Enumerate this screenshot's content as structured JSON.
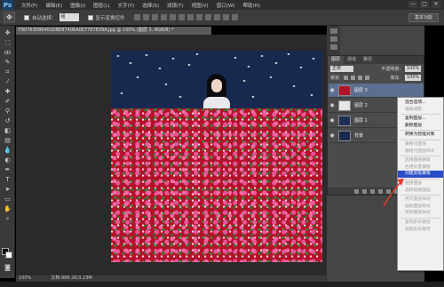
{
  "app": {
    "logo": "Ps"
  },
  "menu": [
    "文件(F)",
    "编辑(E)",
    "图像(I)",
    "图层(L)",
    "文字(Y)",
    "选择(S)",
    "滤镜(T)",
    "视图(V)",
    "窗口(W)",
    "帮助(H)"
  ],
  "window_controls": [
    "—",
    "□",
    "✕"
  ],
  "options": {
    "auto_select_label": "自动选择：",
    "auto_select_value": "组",
    "show_transform_label": "显示变换控件",
    "essentials": "基本功能"
  },
  "document": {
    "tab_title": "F90763086401DBE87406A0E77E7E09A.jpg @ 100% (图层 3, RGB/8) *",
    "zoom": "100%",
    "doc_info": "文档:986.2K/3.23M"
  },
  "layers_panel": {
    "tabs": [
      "图层",
      "通道",
      "路径"
    ],
    "blend_mode": "正常",
    "opacity_label": "不透明度:",
    "opacity_value": "100%",
    "lock_label": "锁定:",
    "fill_label": "填充:",
    "fill_value": "100%",
    "layers": [
      {
        "name": "图层 3",
        "selected": true
      },
      {
        "name": "图层 2",
        "selected": false
      },
      {
        "name": "图层 1",
        "selected": false
      },
      {
        "name": "背景",
        "selected": false
      }
    ]
  },
  "context_menu": [
    {
      "label": "混合选项...",
      "state": "normal"
    },
    {
      "label": "编辑调整...",
      "state": "disabled"
    },
    {
      "sep": true
    },
    {
      "label": "复制图层...",
      "state": "normal"
    },
    {
      "label": "删除图层",
      "state": "normal"
    },
    {
      "sep": true
    },
    {
      "label": "转换为智能对象",
      "state": "normal"
    },
    {
      "sep": true
    },
    {
      "label": "栅格化图层",
      "state": "disabled"
    },
    {
      "label": "栅格化图层样式",
      "state": "disabled"
    },
    {
      "sep": true
    },
    {
      "label": "启用图层蒙版",
      "state": "disabled"
    },
    {
      "label": "启用矢量蒙版",
      "state": "disabled"
    },
    {
      "label": "创建剪贴蒙版",
      "state": "highlight"
    },
    {
      "sep": true
    },
    {
      "label": "链接图层",
      "state": "disabled"
    },
    {
      "label": "选择链接图层",
      "state": "disabled"
    },
    {
      "sep": true
    },
    {
      "label": "拷贝图层样式",
      "state": "disabled"
    },
    {
      "label": "粘贴图层样式",
      "state": "disabled"
    },
    {
      "label": "清除图层样式",
      "state": "disabled"
    },
    {
      "sep": true
    },
    {
      "label": "复制形状属性",
      "state": "disabled"
    },
    {
      "label": "粘贴形状属性",
      "state": "disabled"
    }
  ],
  "colors": {
    "selection": "#2b4ec7",
    "fabric": "#b3122a",
    "night": "#17294f",
    "annotation": "#e03a2e"
  }
}
